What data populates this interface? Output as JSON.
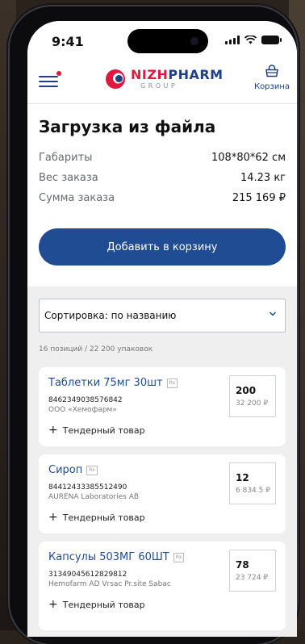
{
  "status_bar": {
    "time": "9:41"
  },
  "header": {
    "logo_main_left": "NIZH",
    "logo_main_right": "PHARM",
    "logo_sub": "GROUP",
    "cart_label": "Корзина"
  },
  "summary": {
    "title": "Загрузка из файла",
    "rows": [
      {
        "label": "Габариты",
        "value": "108*80*62 см"
      },
      {
        "label": "Вес заказа",
        "value": "14.23 кг"
      },
      {
        "label": "Сумма заказа",
        "value": "215 169 ₽"
      }
    ],
    "add_button": "Добавить в корзину"
  },
  "list": {
    "sort_label": "Сортировка: по названию",
    "count": "16 позиций / 22 200 упаковок",
    "items": [
      {
        "name": "Таблетки 75мг 30шт",
        "rx": "Rx",
        "code": "8462349038576842",
        "maker": "ООО «Хемофарм»",
        "tender": "Тендерный товар",
        "qty": "200",
        "sum": "32 200 ₽"
      },
      {
        "name": "Сироп",
        "rx": "Rx",
        "code": "84412433385512490",
        "maker": "AURENA Laboratories AB",
        "tender": "Тендерный товар",
        "qty": "12",
        "sum": "6 834.5 ₽"
      },
      {
        "name": "Капсулы 503МГ 60ШТ",
        "rx": "Rx",
        "code": "31349045612829812",
        "maker": "Hemofarm AD Vrsac Pr.site Sabac",
        "tender": "Тендерный товар",
        "qty": "78",
        "sum": "23 724 ₽"
      }
    ]
  },
  "colors": {
    "brand_blue": "#1f4c92",
    "brand_red": "#e2173f"
  },
  "icons": [
    "menu-icon",
    "notification-dot",
    "cart-icon",
    "chevron-down-icon",
    "rx-badge",
    "plus-icon"
  ]
}
